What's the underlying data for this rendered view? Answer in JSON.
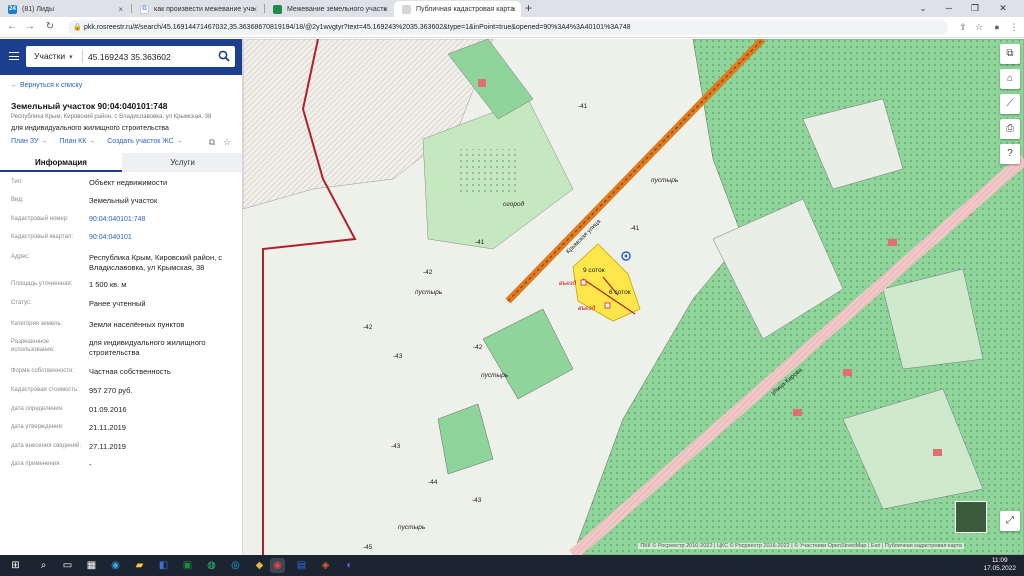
{
  "browser": {
    "tabs": [
      {
        "title": "(81) Лиды",
        "icon_text": "24",
        "icon_color": "#1a7fd1"
      },
      {
        "title": "как произвести межевание уча",
        "icon_text": "G",
        "icon_color": "#ffffff"
      },
      {
        "title": "Межевание земельного участк",
        "icon_text": "",
        "icon_color": "#1f8a4c"
      },
      {
        "title": "Публичная кадастровая карта",
        "icon_text": "",
        "icon_color": "#d6d6d6"
      }
    ],
    "new_tab_label": "+",
    "close_label": "×",
    "url": "pkk.rosreestr.ru/#/search/45.16914471467032,35.36368670819194/18/@2y1wvgtyr?text=45.169243%2035.363602&type=1&inPoint=true&opened=90%3A4%3A40101%3A748",
    "window_controls": {
      "minimize": "─",
      "restore": "❐",
      "close": "✕"
    }
  },
  "panel": {
    "search_type": "Участки",
    "search_value": "45.169243 35.363602",
    "back_link": "← Вернуться к списку",
    "title": "Земельный участок 90:04:040101:748",
    "address_small": "Республика Крым, Кировский район, с Владиславовка, ул Крымская, 38",
    "purpose": "для индивидуального жилищного строительства",
    "links": [
      "План ЗУ →",
      "План КК →",
      "Создать участок ЖС →"
    ],
    "tabs": {
      "info": "Информация",
      "services": "Услуги"
    },
    "properties": [
      {
        "label": "Тип:",
        "value": "Объект недвижимости",
        "link": false
      },
      {
        "label": "Вид:",
        "value": "Земельный участок",
        "link": false
      },
      {
        "label": "Кадастровый номер:",
        "value": "90:04:040101:748",
        "link": true
      },
      {
        "label": "Кадастровый квартал:",
        "value": "90:04:040101",
        "link": true
      },
      {
        "label": "Адрес:",
        "value": "Республика Крым, Кировский район, с Владиславовка, ул Крымская, 38",
        "link": false
      },
      {
        "label": "Площадь уточненная:",
        "value": "1 500 кв. м",
        "link": false
      },
      {
        "label": "Статус:",
        "value": "Ранее учтенный",
        "link": false
      },
      {
        "label": "Категория земель:",
        "value": "Земли населённых пунктов",
        "link": false
      },
      {
        "label": "Разрешенное использование:",
        "value": "для индивидуального жилищного строительства",
        "link": false
      },
      {
        "label": "Форма собственности:",
        "value": "Частная собственность",
        "link": false
      },
      {
        "label": "Кадастровая стоимость:",
        "value": "957 270 руб.",
        "link": false
      },
      {
        "label": "дата определения:",
        "value": "01.09.2016",
        "link": false
      },
      {
        "label": "дата утверждения:",
        "value": "21.11.2019",
        "link": false
      },
      {
        "label": "дата внесения сведений:",
        "value": "27.11.2019",
        "link": false
      },
      {
        "label": "дата применения:",
        "value": "-",
        "link": false
      }
    ]
  },
  "map": {
    "labels": {
      "sotok_9": "9 соток",
      "sotok_6": "6 соток",
      "vezd_1": "въезд",
      "vezd_2": "въезд",
      "street_krymskaya": "Крымская улица",
      "street_kirova": "улица Кирова",
      "pustyr_1": "пустырь",
      "pustyr_2": "пустырь",
      "pustyr_3": "пустырь",
      "pustyr_4": "пустырь",
      "ogorod": "огород",
      "elev": [
        "-41",
        "-42",
        "-42",
        "-43",
        "-44",
        "-45",
        "-43",
        "-43",
        "-41",
        "-41",
        "-42"
      ]
    },
    "copyright": "ПКК © Росреестр 2010-2022 | ЦКС © Росреестр 2016-2022 | © Участники OpenStreetMap | Esri | Публичная кадастровая карта",
    "colors": {
      "green": "#8fd49a",
      "highlight": "#ffe64a",
      "road": "#e07a1f",
      "boundary": "#b0202a"
    }
  },
  "taskbar": {
    "time": "11:09",
    "date": "17.05.2022"
  }
}
